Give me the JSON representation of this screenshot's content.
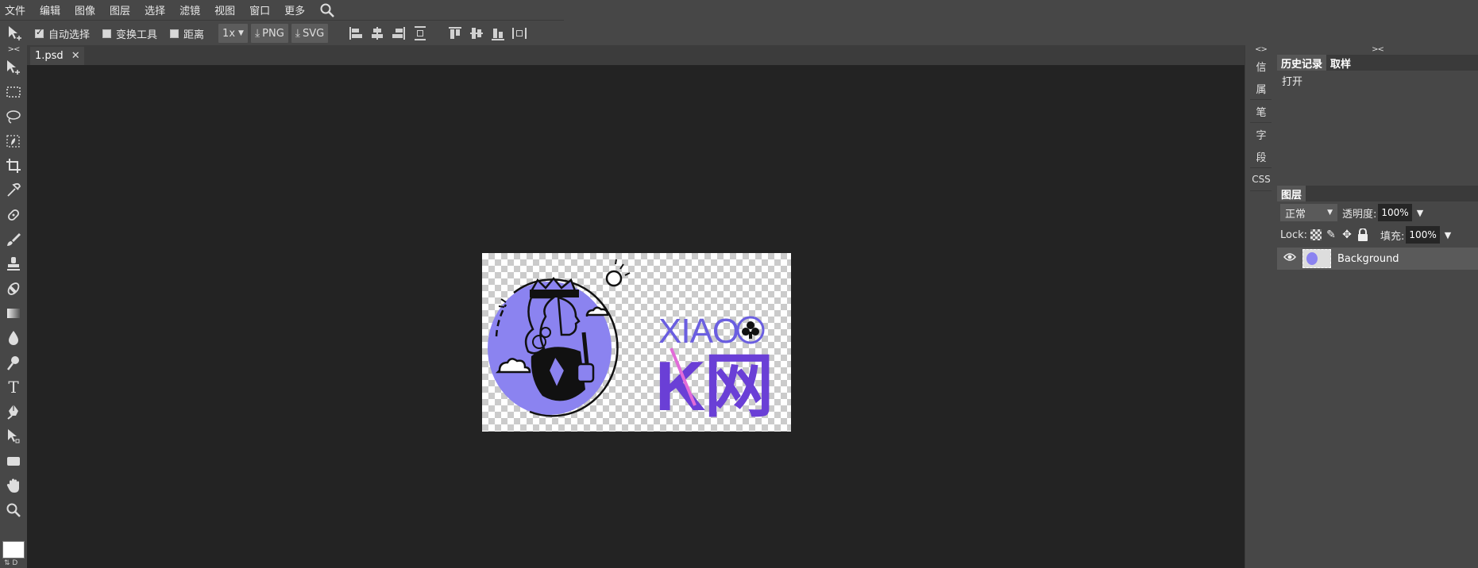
{
  "menu": [
    "文件",
    "编辑",
    "图像",
    "图层",
    "选择",
    "滤镜",
    "视图",
    "窗口",
    "更多"
  ],
  "options": {
    "auto_select": "自动选择",
    "transform": "变换工具",
    "distance": "距离",
    "zoom": "1x",
    "png": "PNG",
    "svg": "SVG"
  },
  "document": {
    "tab_name": "1.psd",
    "close": "✕",
    "logo_line1": "XIAO",
    "logo_line2": "K网"
  },
  "narrow_panel": [
    "信",
    "属",
    "笔",
    "字",
    "段",
    "CSS"
  ],
  "collapse_left": "><",
  "collapse_narrow": "<>",
  "collapse_right": "><",
  "history": {
    "tabs": [
      "历史记录",
      "取样"
    ],
    "items": [
      "打开"
    ]
  },
  "layers": {
    "tab": "图层",
    "blend_mode": "正常",
    "opacity_label": "透明度:",
    "opacity_value": "100%",
    "lock_label": "Lock:",
    "fill_label": "填充:",
    "fill_value": "100%",
    "items": [
      {
        "name": "Background",
        "visible": true
      }
    ]
  },
  "colors": {
    "accent": "#8b83f0",
    "purple_dark": "#6a3fd6",
    "pink": "#e26bd8"
  }
}
